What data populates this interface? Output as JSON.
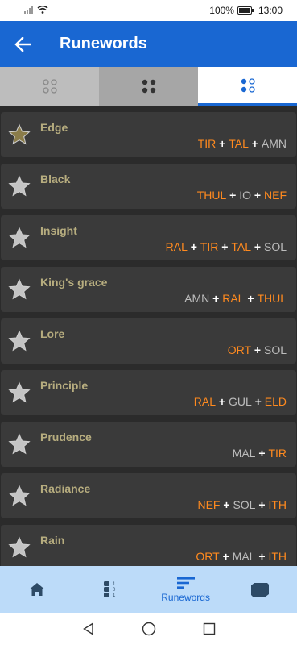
{
  "status_bar": {
    "battery": "100%",
    "time": "13:00"
  },
  "app_bar": {
    "title": "Runewords",
    "back_icon": "arrow-left-icon"
  },
  "tabs": [
    {
      "icon": "rune-circles-outline-icon"
    },
    {
      "icon": "rune-dots-filled-icon"
    },
    {
      "icon": "rune-dots-mixed-icon",
      "selected": true
    }
  ],
  "runewords": [
    {
      "name": "Edge",
      "favorite": true,
      "runes": [
        {
          "r": "TIR",
          "c": "orange"
        },
        {
          "r": "TAL",
          "c": "orange"
        },
        {
          "r": "AMN",
          "c": "gray"
        }
      ]
    },
    {
      "name": "Black",
      "favorite": false,
      "runes": [
        {
          "r": "THUL",
          "c": "orange"
        },
        {
          "r": "IO",
          "c": "gray"
        },
        {
          "r": "NEF",
          "c": "orange"
        }
      ]
    },
    {
      "name": "Insight",
      "favorite": false,
      "runes": [
        {
          "r": "RAL",
          "c": "orange"
        },
        {
          "r": "TIR",
          "c": "orange"
        },
        {
          "r": "TAL",
          "c": "orange"
        },
        {
          "r": "SOL",
          "c": "gray"
        }
      ]
    },
    {
      "name": "King's grace",
      "favorite": false,
      "runes": [
        {
          "r": "AMN",
          "c": "gray"
        },
        {
          "r": "RAL",
          "c": "orange"
        },
        {
          "r": "THUL",
          "c": "orange"
        }
      ]
    },
    {
      "name": "Lore",
      "favorite": false,
      "runes": [
        {
          "r": "ORT",
          "c": "orange"
        },
        {
          "r": "SOL",
          "c": "gray"
        }
      ]
    },
    {
      "name": "Principle",
      "favorite": false,
      "runes": [
        {
          "r": "RAL",
          "c": "orange"
        },
        {
          "r": "GUL",
          "c": "gray"
        },
        {
          "r": "ELD",
          "c": "orange"
        }
      ]
    },
    {
      "name": "Prudence",
      "favorite": false,
      "runes": [
        {
          "r": "MAL",
          "c": "gray"
        },
        {
          "r": "TIR",
          "c": "orange"
        }
      ]
    },
    {
      "name": "Radiance",
      "favorite": false,
      "runes": [
        {
          "r": "NEF",
          "c": "orange"
        },
        {
          "r": "SOL",
          "c": "gray"
        },
        {
          "r": "ITH",
          "c": "orange"
        }
      ]
    },
    {
      "name": "Rain",
      "favorite": false,
      "runes": [
        {
          "r": "ORT",
          "c": "orange"
        },
        {
          "r": "MAL",
          "c": "gray"
        },
        {
          "r": "ITH",
          "c": "orange"
        }
      ]
    }
  ],
  "bottom_nav": [
    {
      "icon": "home-icon",
      "label": ""
    },
    {
      "icon": "rune-stack-icon",
      "label": ""
    },
    {
      "icon": "runewords-list-icon",
      "label": "Runewords",
      "selected": true
    },
    {
      "icon": "cube-icon",
      "label": ""
    }
  ],
  "colors": {
    "accent": "#1967d2",
    "orange_rune": "#ff8a1f",
    "gray_rune": "#bdbdbd",
    "name": "#b7ad7f"
  }
}
